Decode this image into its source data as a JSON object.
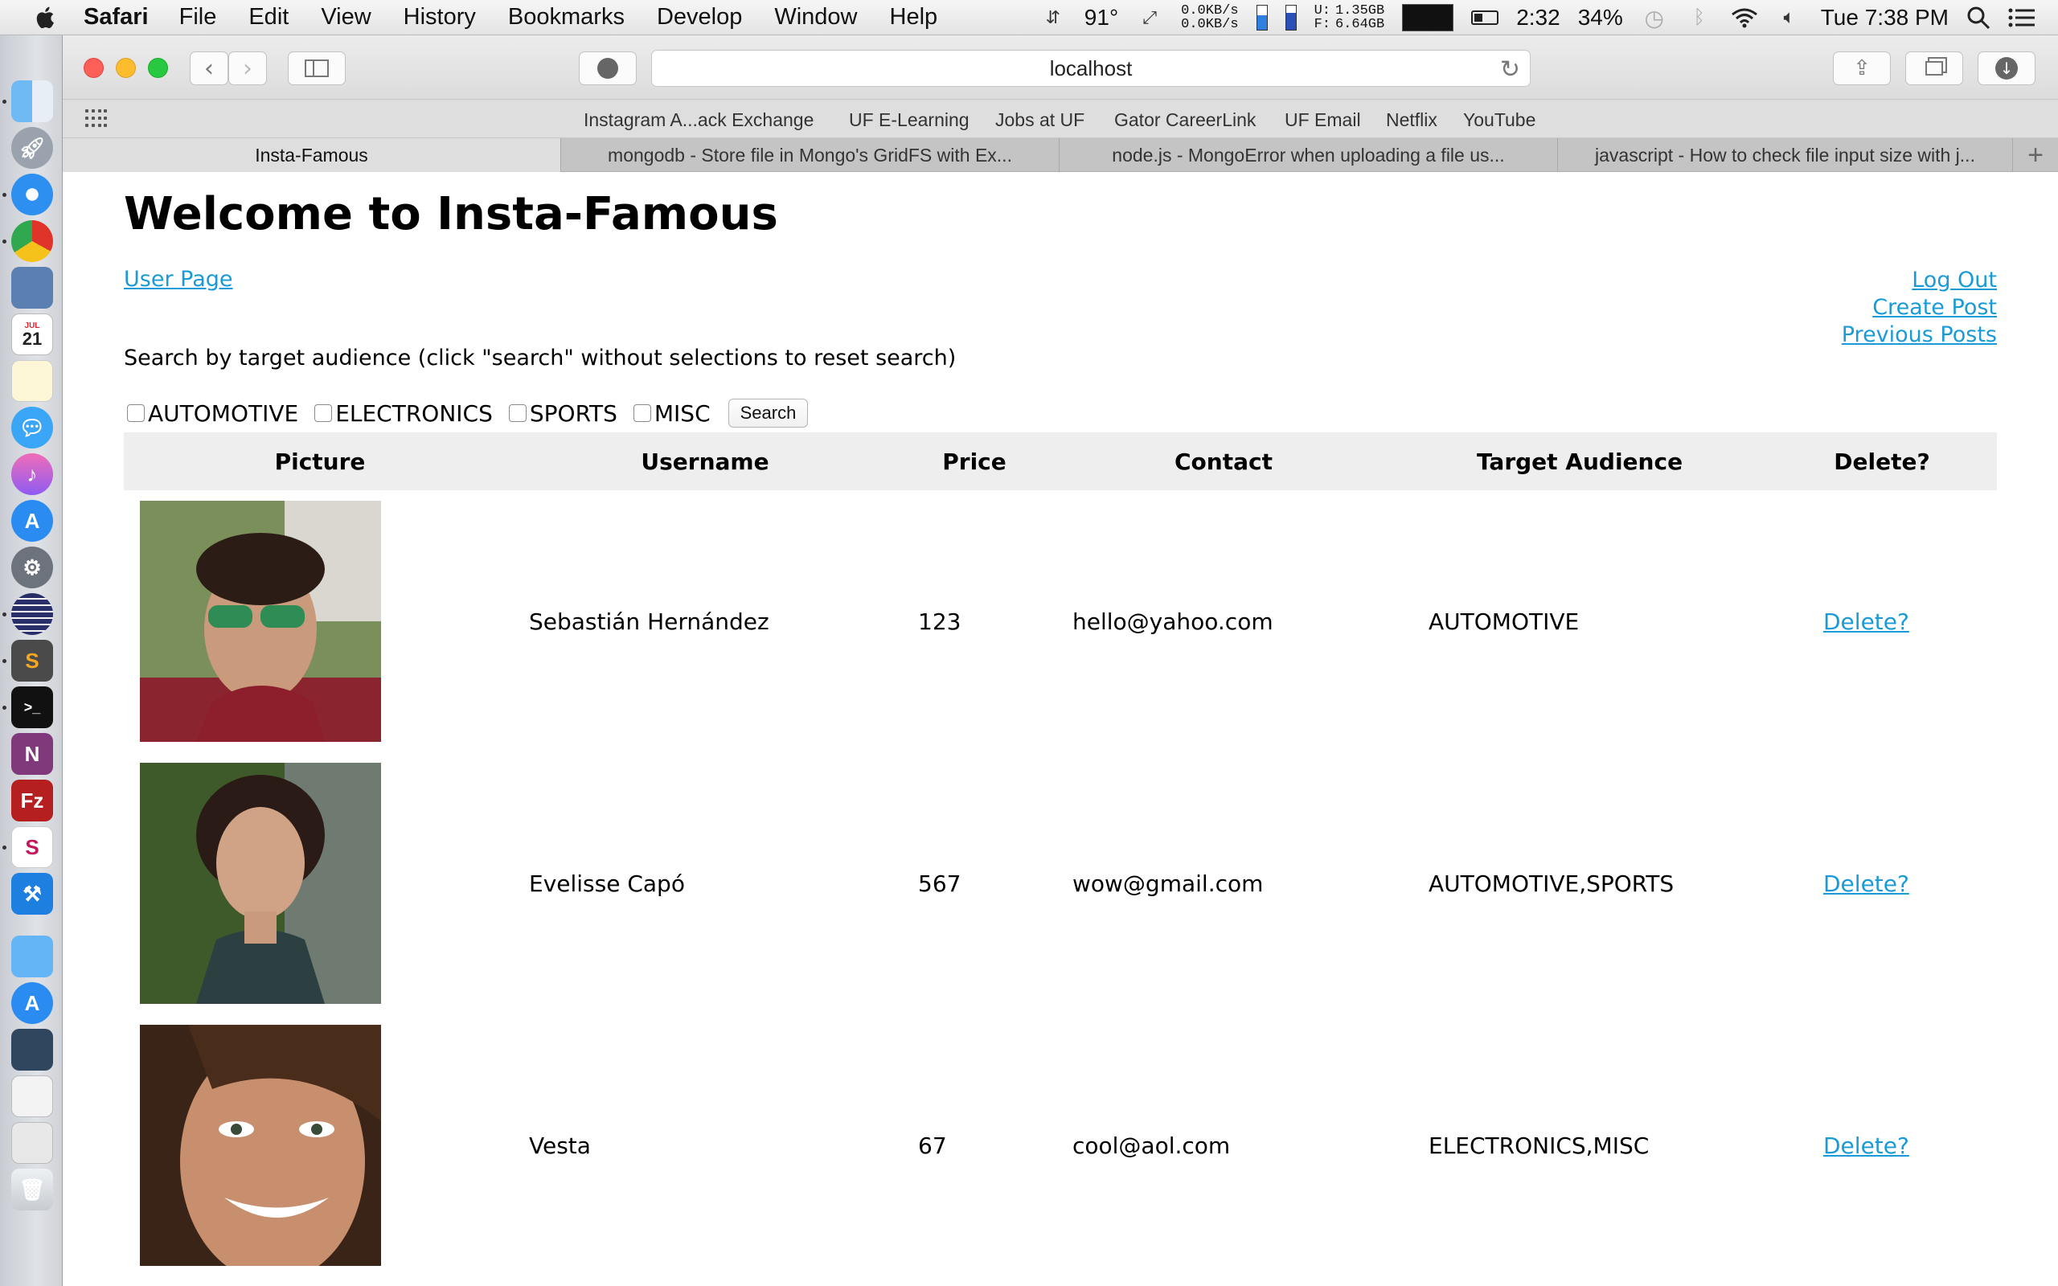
{
  "menubar": {
    "app": "Safari",
    "items": [
      "File",
      "Edit",
      "View",
      "History",
      "Bookmarks",
      "Develop",
      "Window",
      "Help"
    ],
    "temp": "91°",
    "net_up": "0.0KB/s",
    "net_down": "0.0KB/s",
    "mem_used": "1.35GB",
    "mem_free": "6.64GB",
    "mem_used_label": "U:",
    "mem_free_label": "F:",
    "battery_time": "2:32",
    "battery_pct": "34%",
    "clock": "Tue 7:38 PM"
  },
  "browser": {
    "address": "localhost",
    "favorites": [
      "Instagram A...ack Exchange",
      "UF E-Learning",
      "Jobs at UF",
      "Gator CareerLink",
      "UF Email",
      "Netflix",
      "YouTube"
    ],
    "tabs": [
      {
        "label": "Insta-Famous",
        "active": true
      },
      {
        "label": "mongodb - Store file in Mongo's GridFS with Ex..."
      },
      {
        "label": "node.js - MongoError when uploading a file us..."
      },
      {
        "label": "javascript - How to check file input size with j..."
      }
    ],
    "new_tab": "+"
  },
  "dock": {
    "calendar_month": "JUL",
    "calendar_day": "21"
  },
  "page": {
    "title": "Welcome to Insta-Famous",
    "user_page_link": "User Page",
    "logout_link": "Log Out",
    "create_post_link": "Create Post",
    "previous_posts_link": "Previous Posts",
    "search_instructions": "Search by target audience (click \"search\" without selections to reset search)",
    "filters": [
      "AUTOMOTIVE",
      "ELECTRONICS",
      "SPORTS",
      "MISC"
    ],
    "search_button": "Search",
    "table": {
      "headers": [
        "Picture",
        "Username",
        "Price",
        "Contact",
        "Target Audience",
        "Delete?"
      ],
      "rows": [
        {
          "username": "Sebastián Hernández",
          "price": "123",
          "contact": "hello@yahoo.com",
          "audience": "AUTOMOTIVE",
          "delete": "Delete?"
        },
        {
          "username": "Evelisse Capó",
          "price": "567",
          "contact": "wow@gmail.com",
          "audience": "AUTOMOTIVE,SPORTS",
          "delete": "Delete?"
        },
        {
          "username": "Vesta",
          "price": "67",
          "contact": "cool@aol.com",
          "audience": "ELECTRONICS,MISC",
          "delete": "Delete?"
        }
      ]
    }
  }
}
